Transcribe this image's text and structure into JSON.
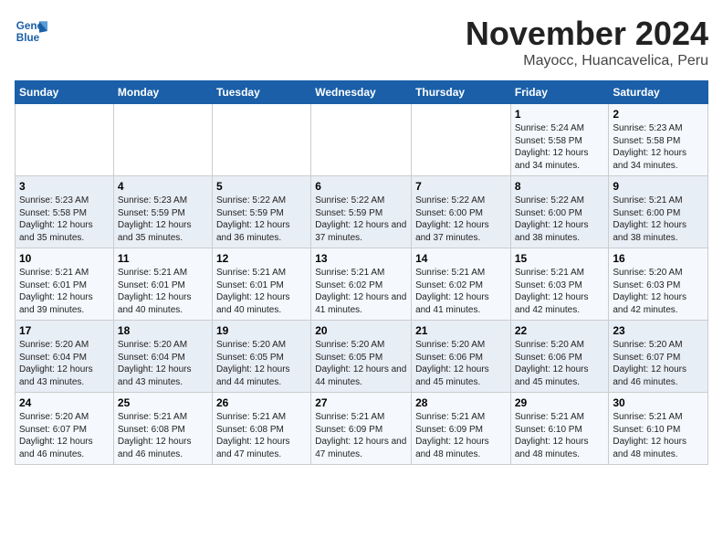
{
  "header": {
    "logo_line1": "General",
    "logo_line2": "Blue",
    "month": "November 2024",
    "location": "Mayocc, Huancavelica, Peru"
  },
  "weekdays": [
    "Sunday",
    "Monday",
    "Tuesday",
    "Wednesday",
    "Thursday",
    "Friday",
    "Saturday"
  ],
  "weeks": [
    [
      {
        "day": "",
        "info": ""
      },
      {
        "day": "",
        "info": ""
      },
      {
        "day": "",
        "info": ""
      },
      {
        "day": "",
        "info": ""
      },
      {
        "day": "",
        "info": ""
      },
      {
        "day": "1",
        "info": "Sunrise: 5:24 AM\nSunset: 5:58 PM\nDaylight: 12 hours\nand 34 minutes."
      },
      {
        "day": "2",
        "info": "Sunrise: 5:23 AM\nSunset: 5:58 PM\nDaylight: 12 hours\nand 34 minutes."
      }
    ],
    [
      {
        "day": "3",
        "info": "Sunrise: 5:23 AM\nSunset: 5:58 PM\nDaylight: 12 hours\nand 35 minutes."
      },
      {
        "day": "4",
        "info": "Sunrise: 5:23 AM\nSunset: 5:59 PM\nDaylight: 12 hours\nand 35 minutes."
      },
      {
        "day": "5",
        "info": "Sunrise: 5:22 AM\nSunset: 5:59 PM\nDaylight: 12 hours\nand 36 minutes."
      },
      {
        "day": "6",
        "info": "Sunrise: 5:22 AM\nSunset: 5:59 PM\nDaylight: 12 hours\nand 37 minutes."
      },
      {
        "day": "7",
        "info": "Sunrise: 5:22 AM\nSunset: 6:00 PM\nDaylight: 12 hours\nand 37 minutes."
      },
      {
        "day": "8",
        "info": "Sunrise: 5:22 AM\nSunset: 6:00 PM\nDaylight: 12 hours\nand 38 minutes."
      },
      {
        "day": "9",
        "info": "Sunrise: 5:21 AM\nSunset: 6:00 PM\nDaylight: 12 hours\nand 38 minutes."
      }
    ],
    [
      {
        "day": "10",
        "info": "Sunrise: 5:21 AM\nSunset: 6:01 PM\nDaylight: 12 hours\nand 39 minutes."
      },
      {
        "day": "11",
        "info": "Sunrise: 5:21 AM\nSunset: 6:01 PM\nDaylight: 12 hours\nand 40 minutes."
      },
      {
        "day": "12",
        "info": "Sunrise: 5:21 AM\nSunset: 6:01 PM\nDaylight: 12 hours\nand 40 minutes."
      },
      {
        "day": "13",
        "info": "Sunrise: 5:21 AM\nSunset: 6:02 PM\nDaylight: 12 hours\nand 41 minutes."
      },
      {
        "day": "14",
        "info": "Sunrise: 5:21 AM\nSunset: 6:02 PM\nDaylight: 12 hours\nand 41 minutes."
      },
      {
        "day": "15",
        "info": "Sunrise: 5:21 AM\nSunset: 6:03 PM\nDaylight: 12 hours\nand 42 minutes."
      },
      {
        "day": "16",
        "info": "Sunrise: 5:20 AM\nSunset: 6:03 PM\nDaylight: 12 hours\nand 42 minutes."
      }
    ],
    [
      {
        "day": "17",
        "info": "Sunrise: 5:20 AM\nSunset: 6:04 PM\nDaylight: 12 hours\nand 43 minutes."
      },
      {
        "day": "18",
        "info": "Sunrise: 5:20 AM\nSunset: 6:04 PM\nDaylight: 12 hours\nand 43 minutes."
      },
      {
        "day": "19",
        "info": "Sunrise: 5:20 AM\nSunset: 6:05 PM\nDaylight: 12 hours\nand 44 minutes."
      },
      {
        "day": "20",
        "info": "Sunrise: 5:20 AM\nSunset: 6:05 PM\nDaylight: 12 hours\nand 44 minutes."
      },
      {
        "day": "21",
        "info": "Sunrise: 5:20 AM\nSunset: 6:06 PM\nDaylight: 12 hours\nand 45 minutes."
      },
      {
        "day": "22",
        "info": "Sunrise: 5:20 AM\nSunset: 6:06 PM\nDaylight: 12 hours\nand 45 minutes."
      },
      {
        "day": "23",
        "info": "Sunrise: 5:20 AM\nSunset: 6:07 PM\nDaylight: 12 hours\nand 46 minutes."
      }
    ],
    [
      {
        "day": "24",
        "info": "Sunrise: 5:20 AM\nSunset: 6:07 PM\nDaylight: 12 hours\nand 46 minutes."
      },
      {
        "day": "25",
        "info": "Sunrise: 5:21 AM\nSunset: 6:08 PM\nDaylight: 12 hours\nand 46 minutes."
      },
      {
        "day": "26",
        "info": "Sunrise: 5:21 AM\nSunset: 6:08 PM\nDaylight: 12 hours\nand 47 minutes."
      },
      {
        "day": "27",
        "info": "Sunrise: 5:21 AM\nSunset: 6:09 PM\nDaylight: 12 hours\nand 47 minutes."
      },
      {
        "day": "28",
        "info": "Sunrise: 5:21 AM\nSunset: 6:09 PM\nDaylight: 12 hours\nand 48 minutes."
      },
      {
        "day": "29",
        "info": "Sunrise: 5:21 AM\nSunset: 6:10 PM\nDaylight: 12 hours\nand 48 minutes."
      },
      {
        "day": "30",
        "info": "Sunrise: 5:21 AM\nSunset: 6:10 PM\nDaylight: 12 hours\nand 48 minutes."
      }
    ]
  ]
}
